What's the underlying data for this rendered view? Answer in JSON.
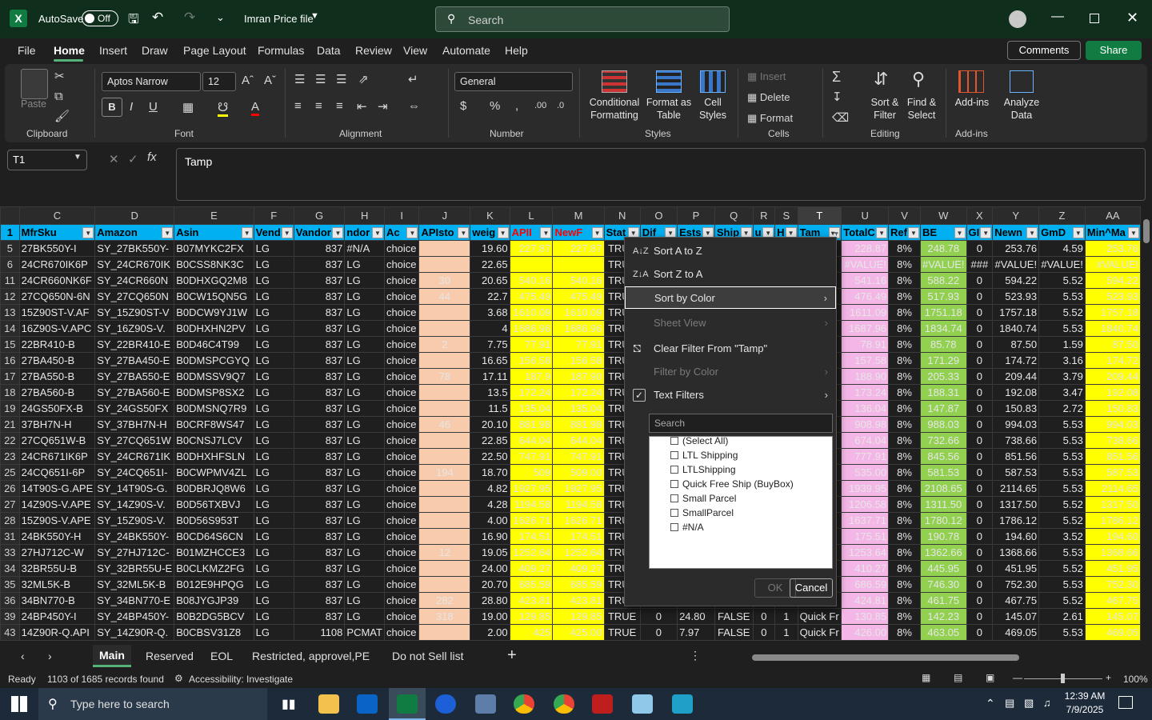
{
  "titlebar": {
    "autosave_label": "AutoSave",
    "autosave_state": "Off",
    "filename": "Imran Price file",
    "search_placeholder": "Search"
  },
  "menu": {
    "items": [
      "File",
      "Home",
      "Insert",
      "Draw",
      "Page Layout",
      "Formulas",
      "Data",
      "Review",
      "View",
      "Automate",
      "Help"
    ],
    "active": "Home",
    "comments": "Comments",
    "share": "Share"
  },
  "ribbon": {
    "clipboard": {
      "label": "Clipboard",
      "paste": "Paste"
    },
    "font": {
      "label": "Font",
      "name": "Aptos Narrow",
      "size": "12"
    },
    "alignment": {
      "label": "Alignment"
    },
    "number": {
      "label": "Number",
      "format": "General"
    },
    "styles": {
      "label": "Styles",
      "conditional": "Conditional",
      "conditional2": "Formatting",
      "format_table": "Format as",
      "format_table2": "Table",
      "cell_styles": "Cell",
      "cell_styles2": "Styles"
    },
    "cells": {
      "label": "Cells",
      "insert": "Insert",
      "delete": "Delete",
      "format": "Format"
    },
    "editing": {
      "label": "Editing",
      "sort": "Sort &",
      "sort2": "Filter",
      "find": "Find &",
      "find2": "Select"
    },
    "addins": {
      "label": "Add-ins",
      "addins": "Add-ins",
      "analyze": "Analyze",
      "analyze2": "Data"
    }
  },
  "formula": {
    "namebox": "T1",
    "value": "Tamp"
  },
  "grid": {
    "columns": [
      "C",
      "D",
      "E",
      "F",
      "G",
      "H",
      "I",
      "J",
      "K",
      "L",
      "M",
      "N",
      "O",
      "P",
      "Q",
      "R",
      "S",
      "T",
      "U",
      "V",
      "W",
      "X",
      "Y",
      "Z",
      "AA"
    ],
    "headers": [
      "MfrSku",
      "Amazon",
      "Asin",
      "Vend",
      "Vandor",
      "ndor",
      "Ac",
      "APIsto",
      "weig",
      "APII",
      "NewF",
      "Stat",
      "Dif",
      "Ests",
      "Ship",
      "u",
      "H",
      "Tam",
      "TotalC",
      "Ref",
      "BE",
      "GI",
      "Newn",
      "GmD",
      "Min^Ma"
    ],
    "rows": [
      {
        "n": "5",
        "c": [
          "27BK550Y-I",
          "SY_27BK550Y-",
          "B07MYKC2FX",
          "LG",
          "837",
          "#N/A",
          "choice",
          "",
          "19.60",
          "227.87",
          "227.87",
          "TRUE",
          "",
          "",
          "",
          "",
          "",
          "",
          "228.87",
          "8%",
          "248.78",
          "0",
          "253.76",
          "4.59",
          "253.76"
        ]
      },
      {
        "n": "6",
        "c": [
          "24CR670IK6P",
          "SY_24CR670IK",
          "B0CSS8NK3C",
          "LG",
          "837",
          "LG",
          "choice",
          "",
          "22.65",
          "",
          "",
          "TRUE",
          "",
          "",
          "",
          "",
          "",
          "",
          "#VALUE!",
          "8%",
          "#VALUE!",
          "###",
          "#VALUE!",
          "#VALUE!",
          "#VALUE!"
        ]
      },
      {
        "n": "11",
        "c": [
          "24CR660NK6F",
          "SY_24CR660N",
          "B0DHXGQ2M8",
          "LG",
          "837",
          "LG",
          "choice",
          "30",
          "20.65",
          "540.16",
          "540.16",
          "TRUE",
          "",
          "",
          "",
          "",
          "",
          "",
          "541.16",
          "8%",
          "588.22",
          "0",
          "594.22",
          "5.52",
          "594.22"
        ]
      },
      {
        "n": "12",
        "c": [
          "27CQ650N-6N",
          "SY_27CQ650N",
          "B0CW15QN5G",
          "LG",
          "837",
          "LG",
          "choice",
          "44",
          "22.7",
          "475.49",
          "475.49",
          "TRUE",
          "",
          "",
          "",
          "",
          "",
          "",
          "476.49",
          "8%",
          "517.93",
          "0",
          "523.93",
          "5.53",
          "523.93"
        ]
      },
      {
        "n": "13",
        "c": [
          "15Z90ST-V.AF",
          "SY_15Z90ST-V",
          "B0DCW9YJ1W",
          "LG",
          "837",
          "LG",
          "choice",
          "",
          "3.68",
          "1610.09",
          "1610.09",
          "TRUE",
          "",
          "",
          "",
          "",
          "",
          "",
          "1611.09",
          "8%",
          "1751.18",
          "0",
          "1757.18",
          "5.52",
          "1757.18"
        ]
      },
      {
        "n": "14",
        "c": [
          "16Z90S-V.APC",
          "SY_16Z90S-V.",
          "B0DHXHN2PV",
          "LG",
          "837",
          "LG",
          "choice",
          "",
          "4",
          "1686.96",
          "1686.96",
          "TRUE",
          "",
          "",
          "",
          "",
          "",
          "",
          "1687.96",
          "8%",
          "1834.74",
          "0",
          "1840.74",
          "5.53",
          "1840.74"
        ]
      },
      {
        "n": "15",
        "c": [
          "22BR410-B",
          "SY_22BR410-E",
          "B0D46C4T99",
          "LG",
          "837",
          "LG",
          "choice",
          "2",
          "7.75",
          "77.91",
          "77.91",
          "TRUE",
          "",
          "",
          "",
          "",
          "",
          "",
          "78.91",
          "8%",
          "85.78",
          "0",
          "87.50",
          "1.59",
          "87.50"
        ]
      },
      {
        "n": "16",
        "c": [
          "27BA450-B",
          "SY_27BA450-E",
          "B0DMSPCGYQ",
          "LG",
          "837",
          "LG",
          "choice",
          "",
          "16.65",
          "156.58",
          "156.58",
          "TRUE",
          "",
          "",
          "",
          "",
          "",
          "",
          "157.58",
          "8%",
          "171.29",
          "0",
          "174.72",
          "3.16",
          "174.72"
        ]
      },
      {
        "n": "17",
        "c": [
          "27BA550-B",
          "SY_27BA550-E",
          "B0DMSSV9Q7",
          "LG",
          "837",
          "LG",
          "choice",
          "78",
          "17.11",
          "187.9",
          "187.90",
          "TRUE",
          "",
          "",
          "",
          "",
          "",
          "",
          "188.90",
          "8%",
          "205.33",
          "0",
          "209.44",
          "3.79",
          "209.44"
        ]
      },
      {
        "n": "18",
        "c": [
          "27BA560-B",
          "SY_27BA560-E",
          "B0DMSP8SX2",
          "LG",
          "837",
          "LG",
          "choice",
          "",
          "13.5",
          "172.24",
          "172.24",
          "TRUE",
          "",
          "",
          "",
          "",
          "",
          "",
          "173.24",
          "8%",
          "188.31",
          "0",
          "192.08",
          "3.47",
          "192.08"
        ]
      },
      {
        "n": "19",
        "c": [
          "24GS50FX-B",
          "SY_24GS50FX",
          "B0DMSNQ7R9",
          "LG",
          "837",
          "LG",
          "choice",
          "",
          "11.5",
          "135.04",
          "135.04",
          "TRUE",
          "",
          "",
          "",
          "",
          "",
          "",
          "136.04",
          "8%",
          "147.87",
          "0",
          "150.83",
          "2.72",
          "150.83"
        ]
      },
      {
        "n": "21",
        "c": [
          "37BH7N-H",
          "SY_37BH7N-H",
          "B0CRF8WS47",
          "LG",
          "837",
          "LG",
          "choice",
          "46",
          "20.10",
          "881.98",
          "881.98",
          "TRUE",
          "",
          "",
          "",
          "",
          "",
          "",
          "908.98",
          "8%",
          "988.03",
          "0",
          "994.03",
          "5.53",
          "994.03"
        ]
      },
      {
        "n": "22",
        "c": [
          "27CQ651W-B",
          "SY_27CQ651W",
          "B0CNSJ7LCV",
          "LG",
          "837",
          "LG",
          "choice",
          "",
          "22.85",
          "644.04",
          "644.04",
          "TRUE",
          "",
          "",
          "",
          "",
          "",
          "",
          "674.04",
          "8%",
          "732.66",
          "0",
          "738.66",
          "5.53",
          "738.66"
        ]
      },
      {
        "n": "23",
        "c": [
          "24CR671IK6P",
          "SY_24CR671IK",
          "B0DHXHFSLN",
          "LG",
          "837",
          "LG",
          "choice",
          "",
          "22.50",
          "747.91",
          "747.91",
          "TRUE",
          "",
          "",
          "",
          "",
          "",
          "",
          "777.91",
          "8%",
          "845.56",
          "0",
          "851.56",
          "5.53",
          "851.56"
        ]
      },
      {
        "n": "25",
        "c": [
          "24CQ651I-6P",
          "SY_24CQ651I-",
          "B0CWPMV4ZL",
          "LG",
          "837",
          "LG",
          "choice",
          "194",
          "18.70",
          "509",
          "509.00",
          "TRUE",
          "",
          "",
          "",
          "",
          "",
          "",
          "535.00",
          "8%",
          "581.53",
          "0",
          "587.53",
          "5.53",
          "587.53"
        ]
      },
      {
        "n": "26",
        "c": [
          "14T90S-G.APE",
          "SY_14T90S-G.",
          "B0DBRJQ8W6",
          "LG",
          "837",
          "LG",
          "choice",
          "",
          "4.82",
          "1927.95",
          "1927.95",
          "TRUE",
          "",
          "",
          "",
          "",
          "",
          "",
          "1939.95",
          "8%",
          "2108.65",
          "0",
          "2114.65",
          "5.53",
          "2114.65"
        ]
      },
      {
        "n": "27",
        "c": [
          "14Z90S-V.APE",
          "SY_14Z90S-V.",
          "B0D56TXBVJ",
          "LG",
          "837",
          "LG",
          "choice",
          "",
          "4.28",
          "1194.58",
          "1194.58",
          "TRUE",
          "",
          "",
          "",
          "",
          "",
          "",
          "1206.58",
          "8%",
          "1311.50",
          "0",
          "1317.50",
          "5.52",
          "1317.50"
        ]
      },
      {
        "n": "28",
        "c": [
          "15Z90S-V.APE",
          "SY_15Z90S-V.",
          "B0D56S953T",
          "LG",
          "837",
          "LG",
          "choice",
          "",
          "4.00",
          "1626.71",
          "1626.71",
          "TRUE",
          "",
          "",
          "",
          "",
          "",
          "",
          "1637.71",
          "8%",
          "1780.12",
          "0",
          "1786.12",
          "5.52",
          "1786.12"
        ]
      },
      {
        "n": "31",
        "c": [
          "24BK550Y-H",
          "SY_24BK550Y-",
          "B0CD64S6CN",
          "LG",
          "837",
          "LG",
          "choice",
          "",
          "16.90",
          "174.51",
          "174.51",
          "TRUE",
          "",
          "",
          "",
          "",
          "",
          "",
          "175.51",
          "8%",
          "190.78",
          "0",
          "194.60",
          "3.52",
          "194.60"
        ]
      },
      {
        "n": "33",
        "c": [
          "27HJ712C-W",
          "SY_27HJ712C-",
          "B01MZHCCE3",
          "LG",
          "837",
          "LG",
          "choice",
          "12",
          "19.05",
          "1252.64",
          "1252.64",
          "TRUE",
          "",
          "",
          "",
          "",
          "",
          "",
          "1253.64",
          "8%",
          "1362.66",
          "0",
          "1368.66",
          "5.53",
          "1368.66"
        ]
      },
      {
        "n": "34",
        "c": [
          "32BR55U-B",
          "SY_32BR55U-E",
          "B0CLKMZ2FG",
          "LG",
          "837",
          "LG",
          "choice",
          "",
          "24.00",
          "409.27",
          "409.27",
          "TRUE",
          "",
          "",
          "",
          "",
          "",
          "",
          "410.27",
          "8%",
          "445.95",
          "0",
          "451.95",
          "5.52",
          "451.95"
        ]
      },
      {
        "n": "35",
        "c": [
          "32ML5K-B",
          "SY_32ML5K-B",
          "B012E9HPQG",
          "LG",
          "837",
          "LG",
          "choice",
          "",
          "20.70",
          "685.59",
          "685.59",
          "TRUE",
          "",
          "",
          "",
          "",
          "",
          "",
          "686.59",
          "8%",
          "746.30",
          "0",
          "752.30",
          "5.53",
          "752.30"
        ]
      },
      {
        "n": "36",
        "c": [
          "34BN770-B",
          "SY_34BN770-E",
          "B08JYGJP39",
          "LG",
          "837",
          "LG",
          "choice",
          "282",
          "28.80",
          "423.81",
          "423.81",
          "TRUE",
          "",
          "",
          "",
          "",
          "",
          "",
          "424.81",
          "8%",
          "461.75",
          "0",
          "467.75",
          "5.52",
          "467.75"
        ]
      },
      {
        "n": "39",
        "c": [
          "24BP450Y-I",
          "SY_24BP450Y-",
          "B0B2DG5BCV",
          "LG",
          "837",
          "LG",
          "choice",
          "318",
          "19.00",
          "129.85",
          "129.85",
          "TRUE",
          "0",
          "24.80",
          "FALSE",
          "0",
          "1",
          "Quick Fr",
          "130.85",
          "8%",
          "142.23",
          "0",
          "145.07",
          "2.61",
          "145.07"
        ]
      },
      {
        "n": "43",
        "c": [
          "14Z90R-Q.API",
          "SY_14Z90R-Q.",
          "B0CBSV31Z8",
          "LG",
          "1108",
          "PCMAT",
          "choice",
          "",
          "2.00",
          "425",
          "425.00",
          "TRUE",
          "0",
          "7.97",
          "FALSE",
          "0",
          "1",
          "Quick Fr",
          "426.00",
          "8%",
          "463.05",
          "0",
          "469.05",
          "5.53",
          "469.05"
        ]
      }
    ]
  },
  "filter_menu": {
    "sort_az": "Sort A to Z",
    "sort_za": "Sort Z to A",
    "sort_color": "Sort by Color",
    "sheet_view": "Sheet View",
    "clear_filter": "Clear Filter From \"Tamp\"",
    "filter_color": "Filter by Color",
    "text_filters": "Text Filters",
    "search_placeholder": "Search",
    "options": [
      "(Select All)",
      "LTL Shipping",
      "LTLShipping",
      "Quick Free Ship (BuyBox)",
      "Small Parcel",
      "SmallParcel",
      "#N/A"
    ],
    "ok": "OK",
    "cancel": "Cancel"
  },
  "sheets": {
    "tabs": [
      "Main",
      "Reserved",
      "EOL",
      "Restricted, approvel,PE",
      "Do not Sell list"
    ],
    "active": "Main"
  },
  "status": {
    "ready": "Ready",
    "records": "1103 of 1685 records found",
    "accessibility": "Accessibility: Investigate",
    "zoom": "100%"
  },
  "taskbar": {
    "search_placeholder": "Type here to search",
    "time": "12:39 AM",
    "date": "7/9/2025"
  },
  "colors": {
    "filter_header": "#00b0f0",
    "salmon": "#f8cbad",
    "yellow": "#ffff00",
    "pink": "#f4b6e6",
    "excel_green": "#107c41"
  }
}
